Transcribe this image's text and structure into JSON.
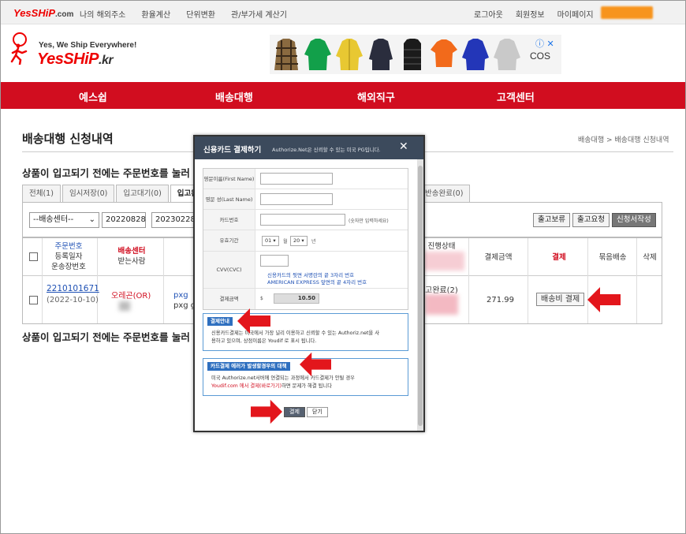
{
  "topbar": {
    "logo_main": "YesSHiP",
    "logo_dot": ".com",
    "nav": [
      "나의 해외주소",
      "환율계산",
      "단위변환",
      "관/부가세 계산기"
    ],
    "links": [
      "로그아웃",
      "회원정보",
      "마이페이지"
    ]
  },
  "header": {
    "tagline": "Yes, We Ship Everywhere!",
    "logo_main": "YesSHiP",
    "logo_suffix": ".kr",
    "ad_brand": "COS",
    "ad_close": "ⓘ ✕"
  },
  "rednav": [
    "예스쉽",
    "배송대행",
    "해외직구",
    "고객센터"
  ],
  "page": {
    "title": "배송대행 신청내역",
    "breadcrumb": "배송대행 > 배송대행 신청내역",
    "notice": "상품이 입고되기 전에는 주문번호를 눌러"
  },
  "tabs": [
    "전체(1)",
    "임시저장(0)",
    "입고대기(0)",
    "입고완료"
  ],
  "tab_right": "반송완료(0)",
  "filter": {
    "center": "--배송센터--",
    "date_from": "20220828",
    "date_to": "20230228",
    "buttons": [
      "출고보류",
      "출고요청",
      "신청서작성"
    ]
  },
  "table": {
    "headers": {
      "order": [
        "주문번호",
        "등록일자",
        "운송장번호"
      ],
      "center": [
        "배송센터",
        "받는사람"
      ],
      "status": "진행상태",
      "pay_amount": "결제금액",
      "pay": "결제",
      "bundle": "묶음배송",
      "delete": "삭제"
    },
    "row": {
      "order_no": "2210101671",
      "date": "(2022-10-10)",
      "center": "오레곤(OR)",
      "item1": "pxg",
      "item2": "pxg go",
      "status": "고완료(2)",
      "amount": "271.99",
      "pay_button": "배송비 결제"
    }
  },
  "modal": {
    "title": "신용카드 결제하기",
    "subtitle": "Authorize.Net은 신뢰할 수 있는 미국 PG입니다.",
    "close": "✕",
    "fields": {
      "first_name": "영문이름(First Name)",
      "last_name": "영문 성(Last Name)",
      "card": "카드번호",
      "card_note": "(숫자만 입력하세요)",
      "expiry": "유효기간",
      "month": "01 ▾",
      "month_label": "월",
      "year": "20 ▾",
      "year_label": "년",
      "cvv": "CVV(CVC)",
      "cvv_note1": "신용카드의 뒷면 서명란의 끝 3자리 번호",
      "cvv_note2": "AMERICAN EXPRESS 앞면의 끝 4자리 번호",
      "amount_label": "결제금액",
      "currency": "$",
      "amount": "10.50"
    },
    "info1": {
      "title": "결제안내",
      "text1": "신용카드결제는 미국에서 가장 널리 이용하고 신뢰할 수 있는 Authoriz.net을 사",
      "text2": "용하고 있으며, 상점이름은 Youdif 로 표시 됩니다."
    },
    "info2": {
      "title": "카드결제 에러가 발생할경우의 대책",
      "text1": "미국 Authorize.net서버에 연결되는 과정에서 카드결제가 안될 경우",
      "text2a": "Youdif.com 에서 결제(바로가기)",
      "text2b": "하면 문제가 해결 됩니다"
    },
    "pay_button": "결제",
    "close_button": "닫기"
  },
  "colors": {
    "brand_red": "#d10d1f",
    "modal_header": "#3c4a5c",
    "link_blue": "#1e50b4",
    "arrow_red": "#e3161c"
  }
}
